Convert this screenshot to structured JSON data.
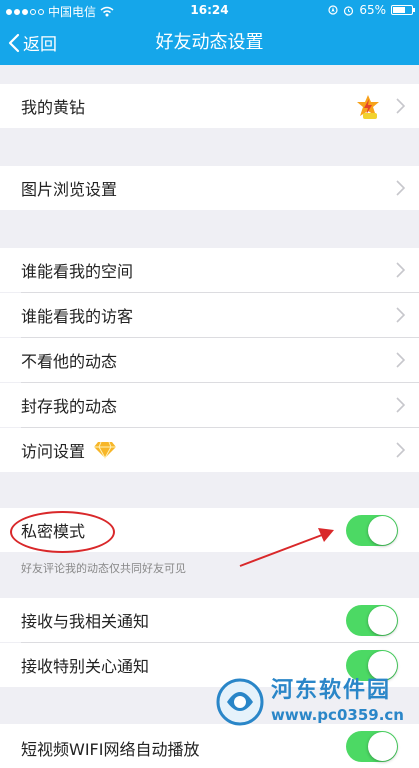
{
  "status": {
    "carrier": "中国电信",
    "time": "16:24",
    "battery": "65%",
    "battery_level": 0.65
  },
  "nav": {
    "back_label": "返回",
    "title": "好友动态设置"
  },
  "rows": [
    {
      "label": "我的黄钻"
    },
    {
      "label": "图片浏览设置"
    },
    {
      "label": "谁能看我的空间"
    },
    {
      "label": "谁能看我的访客"
    },
    {
      "label": "不看他的动态"
    },
    {
      "label": "封存我的动态"
    },
    {
      "label": "访问设置"
    },
    {
      "label": "私密模式",
      "on": true
    },
    {
      "label": "接收与我相关通知",
      "on": true
    },
    {
      "label": "接收特别关心通知",
      "on": true
    },
    {
      "label": "短视频WIFI网络自动播放",
      "on": true
    }
  ],
  "private_hint": "好友评论我的动态仅共同好友可见",
  "watermark": {
    "title": "河东软件园",
    "url": "www.pc0359.cn"
  },
  "colors": {
    "accent": "#15a6ea",
    "toggle_on": "#4cd964",
    "annotation": "#d9282a"
  }
}
